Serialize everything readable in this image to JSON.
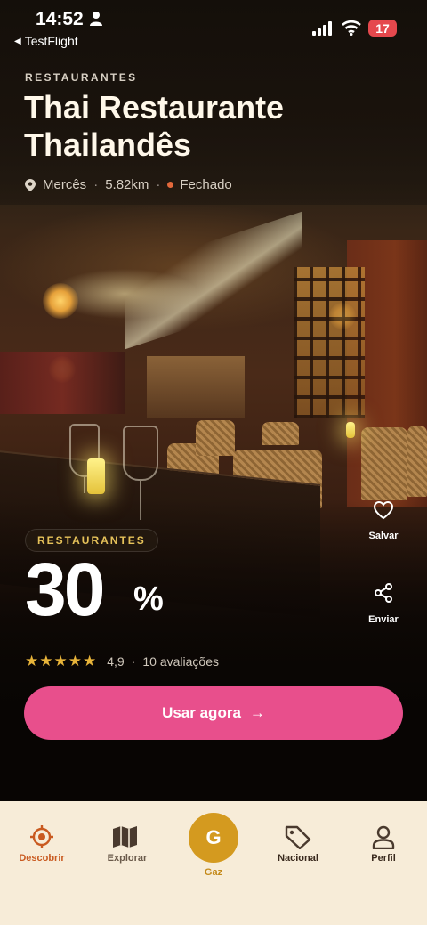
{
  "status_bar": {
    "time": "14:52",
    "back_app": "TestFlight",
    "battery": "17",
    "battery_color": "#e5484d"
  },
  "header": {
    "category": "RESTAURANTES",
    "title": "Thai Restaurante Thailandês",
    "location": "Mercês",
    "distance": "5.82km",
    "status": "Fechado",
    "status_color": "#e2683b"
  },
  "offer": {
    "tag": "RESTAURANTES",
    "value": "30",
    "unit": "%",
    "tag_color": "#e6c25a"
  },
  "actions": {
    "save_label": "Salvar",
    "share_label": "Enviar"
  },
  "rating": {
    "stars": 5,
    "score": "4,9",
    "reviews": "10 avaliações"
  },
  "cta": {
    "label": "Usar agora",
    "arrow": "→",
    "color": "#e84f8c"
  },
  "nav": {
    "items": [
      {
        "label": "Descobrir",
        "icon": "target-icon",
        "active": true
      },
      {
        "label": "Explorar",
        "icon": "map-icon",
        "active": false
      },
      {
        "label": "Gaz",
        "icon": "gaz-g-icon",
        "center_letter": "G",
        "active": false
      },
      {
        "label": "Nacional",
        "icon": "tag-icon",
        "active": false
      },
      {
        "label": "Perfil",
        "icon": "person-icon",
        "active": false
      }
    ],
    "active_color": "#c95a20",
    "center_color": "#d49a1f"
  }
}
